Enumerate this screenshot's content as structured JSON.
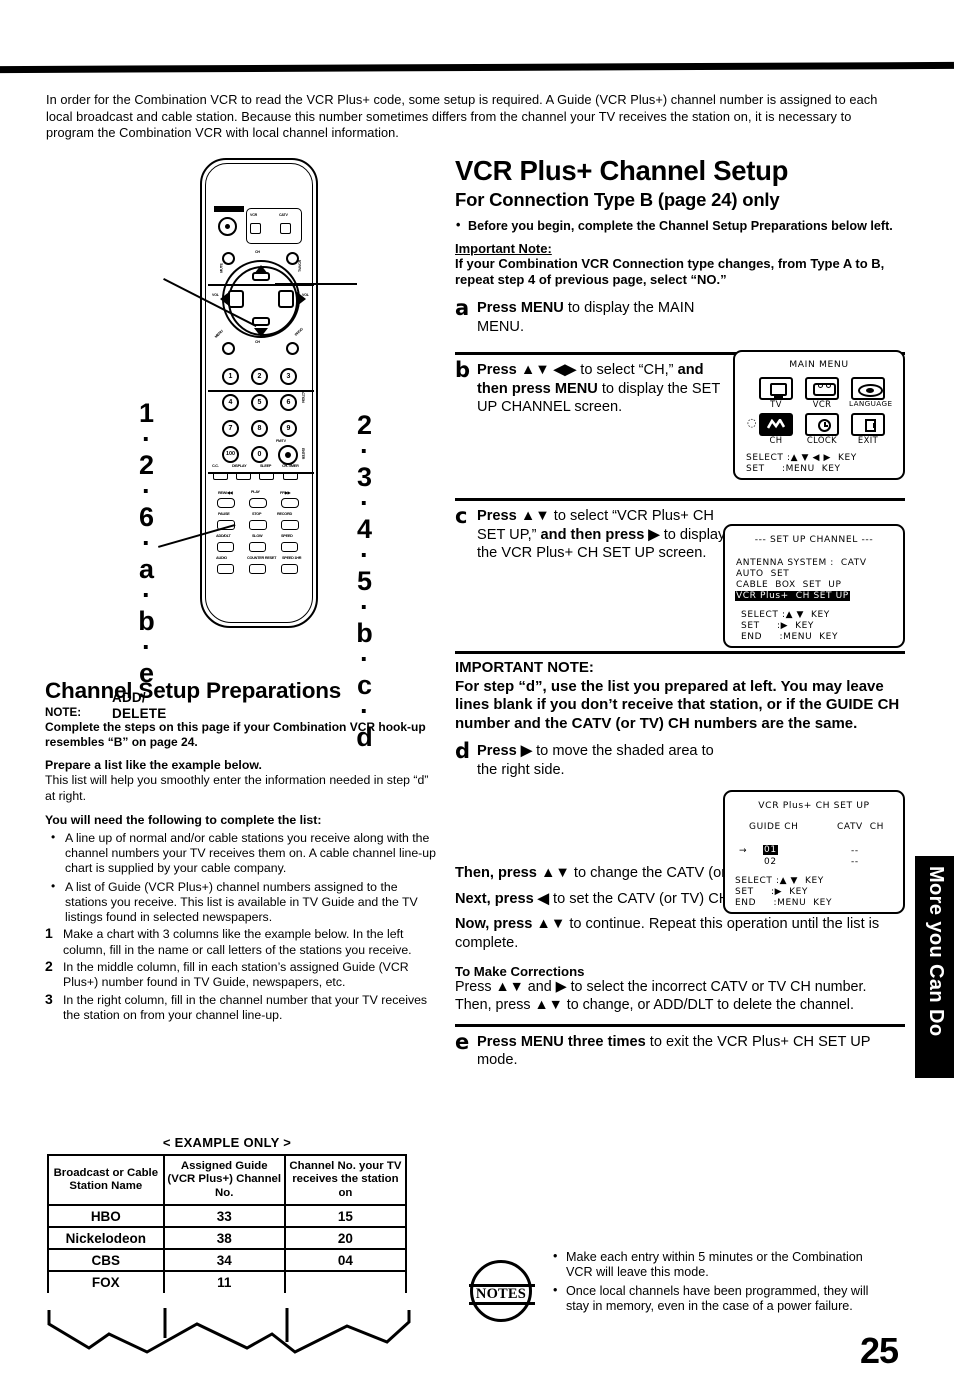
{
  "intro": "In order for the Combination VCR to read the VCR Plus+ code, some setup is required. A Guide (VCR Plus+)  channel number is assigned to each local broadcast and cable station. Because this number sometimes differs from the channel your TV receives the station on, it is necessary to program the Combination VCR with local channel information.",
  "remote": {
    "callout_left": "1·2·6·a·b·e",
    "callout_right": "2·3·4·5·b·c·d",
    "add_delete_label": "ADD/\nDELETE",
    "power_label": "POWER",
    "vcr_label": "VCR",
    "catv_label": "CATV",
    "mute_label": "MUTE",
    "tvvcr_label": "TV/VCR",
    "ch_up_label": "CH",
    "ch_down_label": "CH",
    "vol_left_label": "VOL",
    "vol_right_label": "VOL",
    "menu_label": "MENU",
    "prog_label": "PROG",
    "action_label": "ACTION",
    "keys": [
      "1",
      "2",
      "3",
      "4",
      "5",
      "6",
      "7",
      "8",
      "9",
      "100",
      "0"
    ],
    "fmtv_label": "FM/TV",
    "enter_label": "ENTER",
    "row_labels": [
      "C.C.",
      "DISPLAY",
      "SLEEP",
      "CH-TIMER"
    ],
    "transport_top": [
      "REW/◀◀",
      "PLAY",
      "FF/▶▶"
    ],
    "transport_mid": [
      "PAUSE",
      "STOP",
      "RECORD"
    ],
    "transport_low": [
      "ADD/DLT",
      "SLOW",
      "SPEED"
    ],
    "transport_bot": [
      "AUDIO",
      "COUNTER RESET",
      "SPEED 1HR"
    ]
  },
  "prep": {
    "title": "Channel Setup Preparations",
    "note_label": "NOTE:",
    "note_body": "Complete the steps on this page if your Combination VCR hook-up resembles “B” on page 24.",
    "prepare_head": "Prepare a list like the example below.",
    "prepare_body": "This list will help you smoothly enter the information needed in step “d” at right.",
    "need_head": "You will need the following to complete the list:",
    "bullets": [
      "A line up of normal and/or cable stations you receive along with the channel numbers your TV receives them on. A cable channel line-up chart is supplied by your cable company.",
      "A list of Guide (VCR Plus+) channel numbers assigned to the stations you receive. This list is available in TV Guide and the TV listings found in selected newspapers."
    ],
    "steps": [
      {
        "n": "1",
        "text": "Make a chart with 3 columns like the example below. In the left column, fill in the name or call letters of the stations you receive."
      },
      {
        "n": "2",
        "text": "In the middle column, fill in each station’s assigned Guide (VCR Plus+) number found in TV Guide, newspapers, etc."
      },
      {
        "n": "3",
        "text": "In the right column, fill in the channel number that your TV receives the station on from your channel line-up."
      }
    ]
  },
  "example_table": {
    "caption": "< EXAMPLE ONLY >",
    "headers": [
      "Broadcast or Cable Station Name",
      "Assigned Guide (VCR Plus+) Channel No.",
      "Channel No. your TV receives the station on"
    ],
    "rows": [
      [
        "HBO",
        "33",
        "15"
      ],
      [
        "Nickelodeon",
        "38",
        "20"
      ],
      [
        "CBS",
        "34",
        "04"
      ],
      [
        "FOX",
        "11",
        ""
      ]
    ]
  },
  "right": {
    "title": "VCR Plus+ Channel Setup",
    "subtitle": "For Connection Type B (page 24) only",
    "before_bullet": "Before you begin, complete the Channel Setup Preparations below left.",
    "important_note_head": "Important Note:",
    "important_note_body": "If your Combination VCR Connection type changes, from Type A to B, repeat step 4 of previous page, select “NO.”",
    "step_a": {
      "letter": "a",
      "text_html": "<b>Press MENU</b> to display the MAIN MENU."
    },
    "step_b": {
      "letter": "b",
      "text_html": "<b>Press ▲▼ ◀▶</b>  to select “CH,” <b>and then press MENU</b> to display the SET UP CHANNEL screen."
    },
    "step_c": {
      "letter": "c",
      "text_html": "<b>Press ▲▼</b> to select “VCR Plus+ CH SET UP,” <b>and then press ▶</b> to display the VCR Plus+ CH SET UP screen."
    },
    "step_d": {
      "letter": "d",
      "text_html": "<b>Press ▶</b> to move the shaded area to the right side."
    },
    "step_e": {
      "letter": "e",
      "text_html": "<b>Press MENU three times</b> to exit the VCR Plus+ CH SET UP mode."
    },
    "important2_head": "IMPORTANT NOTE:",
    "important2_body": "For step “d”, use the list you prepared at left. You may leave lines blank if you don’t receive that station, or if the GUIDE CH number and the CATV (or TV) CH numbers are the same.",
    "then_press": "<b>Then, press ▲▼</b> to change the CATV (or TV) CH number.",
    "next_press": "<b>Next, press ◀</b> to set the CATV (or TV) CH number.",
    "now_press": "<b>Now, press ▲▼</b> to continue. Repeat this operation until the list is complete.",
    "corrections_head": "To Make Corrections",
    "corrections_body": "Press ▲▼ and ▶  to select the incorrect CATV or TV CH number.\nThen, press ▲▼ to change, or ADD/DLT to delete the channel."
  },
  "osd_main_menu": {
    "title": "MAIN  MENU",
    "icons": [
      {
        "name": "tv",
        "label": "TV"
      },
      {
        "name": "vcr",
        "label": "VCR"
      },
      {
        "name": "language",
        "label": "LANGUAGE"
      },
      {
        "name": "ch",
        "label": "CH"
      },
      {
        "name": "clock",
        "label": "CLOCK"
      },
      {
        "name": "exit",
        "label": "EXIT"
      }
    ],
    "footer": [
      "SELECT :▲ ▼ ◀ ▶  KEY",
      "SET     :MENU  KEY"
    ]
  },
  "osd_setup_channel": {
    "title": "---  SET UP CHANNEL  ---",
    "lines": [
      "ANTENNA SYSTEM :  CATV",
      "AUTO  SET",
      "CABLE  BOX  SET  UP"
    ],
    "highlighted": "VCR Plus+  CH SET UP",
    "footer": [
      "SELECT :▲ ▼  KEY",
      "SET     :▶  KEY",
      "END     :MENU  KEY"
    ]
  },
  "osd_vcrplus_setup": {
    "title": "VCR  Plus+  CH  SET  UP",
    "col_left": "GUIDE CH",
    "col_right": "CATV  CH",
    "rows": [
      {
        "marker": "→",
        "guide": "01",
        "catv": "--",
        "highlighted": true
      },
      {
        "marker": "",
        "guide": "02",
        "catv": "--",
        "highlighted": false
      }
    ],
    "footer": [
      "SELECT :▲ ▼  KEY",
      "SET     :▶  KEY",
      "END     :MENU  KEY"
    ]
  },
  "notes": {
    "badge": "NOTES",
    "items": [
      "Make each entry within 5 minutes or the Combination VCR will leave this mode.",
      "Once local channels have been programmed, they will stay in memory, even in the case of a power failure."
    ]
  },
  "side_tab": "More you Can Do",
  "page_number": "25"
}
